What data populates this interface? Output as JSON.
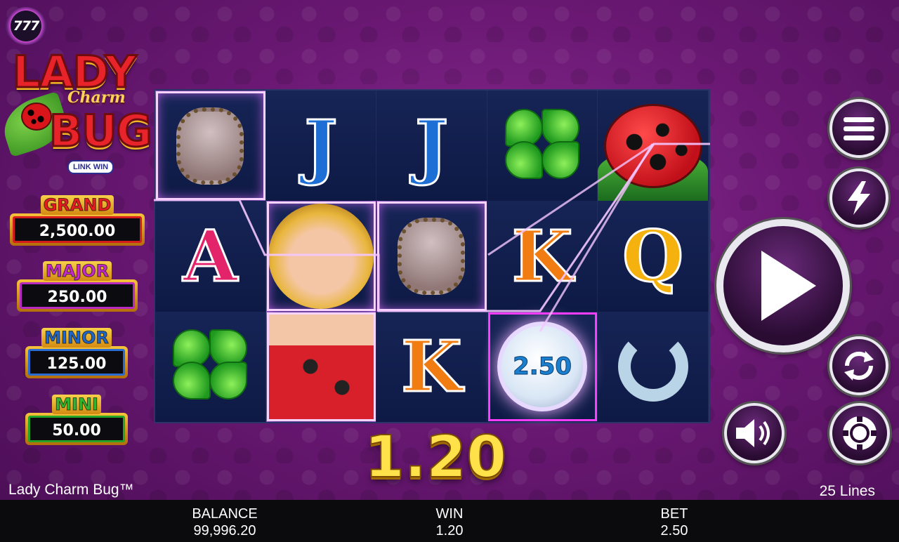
{
  "brand": {
    "badge": "777"
  },
  "logo": {
    "line1": "LADY",
    "line2": "Charm",
    "line3": "BUG",
    "tag": "LINK WIN"
  },
  "jackpots": [
    {
      "name": "GRAND",
      "value": "2,500.00"
    },
    {
      "name": "MAJOR",
      "value": "250.00"
    },
    {
      "name": "MINOR",
      "value": "125.00"
    },
    {
      "name": "MINI",
      "value": "50.00"
    }
  ],
  "reels": {
    "cells": [
      [
        "paw",
        "J",
        "J",
        "clover",
        "ladybug"
      ],
      [
        "A",
        "lady",
        "paw",
        "K",
        "Q"
      ],
      [
        "clover",
        "lady-dress",
        "K",
        "coin",
        "horseshoe"
      ]
    ],
    "coin_value": "2.50",
    "win_highlight": "purple"
  },
  "win_display": "1.20",
  "controls": [
    "menu-icon",
    "turbo-icon",
    "spin-icon",
    "autoplay-icon",
    "sound-icon",
    "bet-chip-icon"
  ],
  "footer": {
    "game_name": "Lady Charm Bug™",
    "lines": "25 Lines",
    "balance_label": "BALANCE",
    "balance_value": "99,996.20",
    "win_label": "WIN",
    "win_value": "1.20",
    "bet_label": "BET",
    "bet_value": "2.50"
  },
  "colors": {
    "background": "#6a1873",
    "win_text": "#ffe14a",
    "footer": "#0b0b0e"
  }
}
